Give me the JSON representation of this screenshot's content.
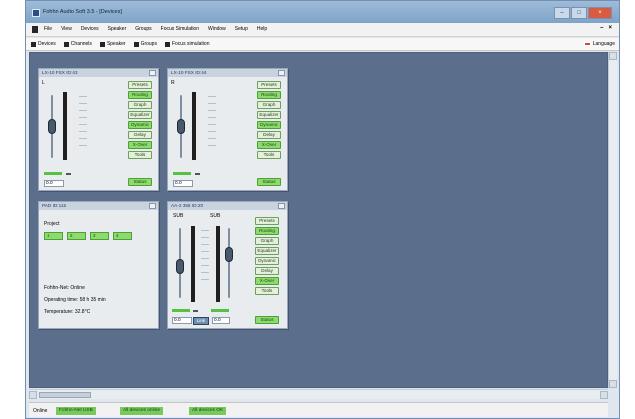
{
  "window": {
    "title": "Fohhn Audio Soft 3.5 - [Devices]",
    "controls": {
      "minimize": "–",
      "maximize": "□",
      "close": "×"
    }
  },
  "menu": {
    "items": [
      "File",
      "View",
      "Devices",
      "Speaker",
      "Groups",
      "Focus Simulation",
      "Window",
      "Setup",
      "Help"
    ],
    "right_controls": [
      "–",
      "×"
    ]
  },
  "toolbar": {
    "items": [
      {
        "label": "Devices",
        "icon": "devices-icon"
      },
      {
        "label": "Channels",
        "icon": "channels-icon"
      },
      {
        "label": "Speaker",
        "icon": "speaker-icon"
      },
      {
        "label": "Groups",
        "icon": "groups-icon"
      },
      {
        "label": "Focus simulation",
        "icon": "focus-simulation-icon"
      }
    ],
    "language": "Language"
  },
  "panels": {
    "lx10_a": {
      "title": "LX-10 FSX ID:43",
      "channel": "L",
      "level": "0.0",
      "buttons": [
        "Presets",
        "Routing",
        "Graph",
        "Equalizer",
        "Dynamic",
        "Delay",
        "X-Over",
        "Tools",
        "Status"
      ]
    },
    "lx10_b": {
      "title": "LX-10 FSX ID:44",
      "channel": "R",
      "level": "0.0",
      "buttons": [
        "Presets",
        "Routing",
        "Graph",
        "Equalizer",
        "Dynamic",
        "Delay",
        "X-Over",
        "Tools",
        "Status"
      ]
    },
    "pad": {
      "title": "PAD ID:115",
      "project_label": "Project",
      "project_buttons": [
        "1",
        "2",
        "3",
        "4"
      ],
      "net_status": "Fohhn-Net: Online",
      "operating_time": "Operating time: 58 h 35 min",
      "temperature": "Temperature: 32.8°C"
    },
    "aa2": {
      "title": "AA-2 355 ID:20",
      "channels": [
        "SUB",
        "SUB"
      ],
      "levels": [
        "0.0",
        "0.0"
      ],
      "link_label": "Link",
      "buttons": [
        "Presets",
        "Routing",
        "Graph",
        "Equalizer",
        "Dynamic",
        "Delay",
        "X-Over",
        "Tools",
        "Status"
      ]
    }
  },
  "statusbar": {
    "online": "Online",
    "interface": "Fohhn-Net USB",
    "devices_online": "All devices online",
    "devices_ok": "All devices OK"
  }
}
